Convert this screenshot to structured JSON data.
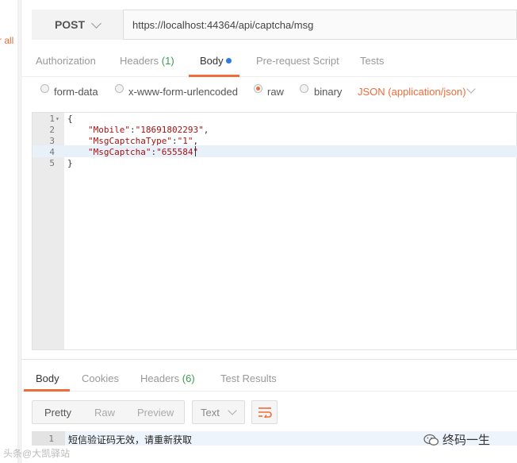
{
  "sidebar": {
    "clear_all": "r all"
  },
  "request": {
    "method": "POST",
    "url": "https://localhost:44364/api/captcha/msg"
  },
  "request_tabs": [
    {
      "label": "Authorization"
    },
    {
      "label": "Headers",
      "count": "(1)"
    },
    {
      "label": "Body"
    },
    {
      "label": "Pre-request Script"
    },
    {
      "label": "Tests"
    }
  ],
  "body_types": {
    "form_data": "form-data",
    "urlencoded": "x-www-form-urlencoded",
    "raw": "raw",
    "binary": "binary",
    "selected": "raw",
    "content_type": "JSON (application/json)"
  },
  "editor": {
    "line_numbers": [
      "1",
      "2",
      "3",
      "4",
      "5"
    ],
    "lines": [
      {
        "text": "{"
      },
      {
        "key": "\"Mobile\"",
        "sep": ":",
        "value": "\"18691802293\"",
        "end": ","
      },
      {
        "key": "\"MsgCaptchaType\"",
        "sep": ":",
        "value": "\"1\"",
        "end": ","
      },
      {
        "key": "\"MsgCaptcha\"",
        "sep": ":",
        "value": "\"655584\"",
        "end": ""
      },
      {
        "text": "}"
      }
    ]
  },
  "response_tabs": [
    {
      "label": "Body"
    },
    {
      "label": "Cookies"
    },
    {
      "label": "Headers",
      "count": "(6)"
    },
    {
      "label": "Test Results"
    }
  ],
  "response_view": {
    "pretty": "Pretty",
    "raw": "Raw",
    "preview": "Preview",
    "format": "Text"
  },
  "response_body": {
    "line_number": "1",
    "text": "短信验证码无效，请重新获取"
  },
  "watermarks": {
    "left": "头条@大凯驿站",
    "right": "终码一生"
  },
  "colors": {
    "accent": "#f26b3a",
    "count_green": "#3a9b4e",
    "dot_blue": "#2d7de0"
  }
}
